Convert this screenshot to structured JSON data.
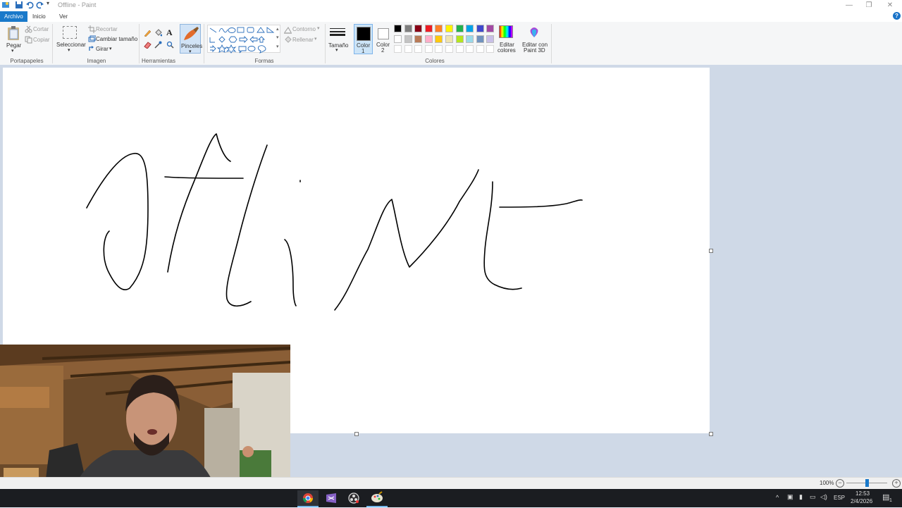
{
  "window": {
    "title": "Offline - Paint"
  },
  "tabs": {
    "file": "Archivo",
    "home": "Inicio",
    "view": "Ver"
  },
  "ribbon": {
    "clipboard": {
      "paste": "Pegar",
      "cut": "Cortar",
      "copy": "Copiar",
      "group": "Portapapeles"
    },
    "image": {
      "select": "Seleccionar",
      "crop": "Recortar",
      "resize": "Cambiar tamaño",
      "rotate": "Girar",
      "group": "Imagen"
    },
    "tools": {
      "group": "Herramientas"
    },
    "brushes": {
      "label": "Pinceles"
    },
    "shapes": {
      "outline": "Contorno",
      "fill": "Rellenar",
      "group": "Formas"
    },
    "size": {
      "label": "Tamaño"
    },
    "color1": {
      "line1": "Color",
      "line2": "1"
    },
    "color2": {
      "line1": "Color",
      "line2": "2"
    },
    "edit_colors": {
      "line1": "Editar",
      "line2": "colores"
    },
    "paint3d": {
      "line1": "Editar con",
      "line2": "Paint 3D"
    },
    "colors_group": "Colores",
    "palette_row1": [
      "#000000",
      "#7f7f7f",
      "#880015",
      "#ed1c24",
      "#ff7f27",
      "#fff200",
      "#22b14c",
      "#00a2e8",
      "#3f48cc",
      "#a349a4"
    ],
    "palette_row2": [
      "#ffffff",
      "#c3c3c3",
      "#b97a57",
      "#ffaec9",
      "#ffc90e",
      "#efe4b0",
      "#b5e61d",
      "#99d9ea",
      "#7092be",
      "#c8bfe7"
    ]
  },
  "status": {
    "zoom": "100%"
  },
  "taskbar": {
    "language": "ESP",
    "time": "12:53",
    "date": "2/4/2026",
    "notification_count": "1"
  },
  "accent": "#1979ca"
}
